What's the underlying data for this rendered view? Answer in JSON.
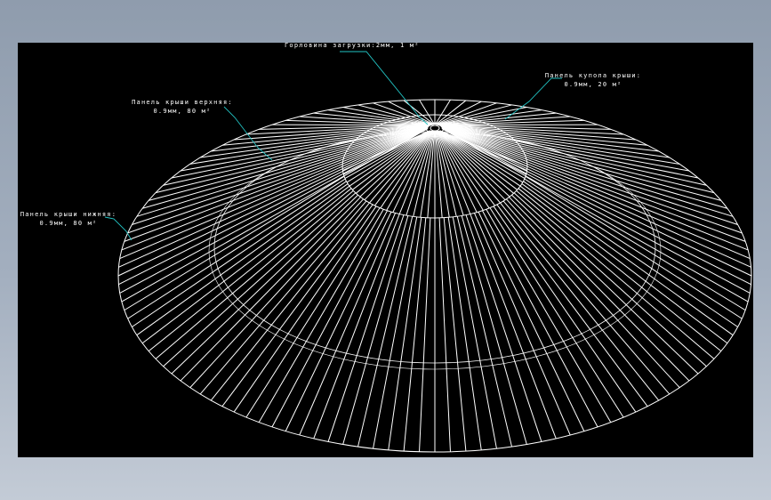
{
  "colors": {
    "frame_background": "#9aa6b6",
    "viewport_background": "#000000",
    "geometry_lines": "#ffffff",
    "leader_lines": "#22c3c3"
  },
  "annotations": [
    {
      "id": "throat",
      "line1": "Горловина загрузки:2мм, 1 м²",
      "line2": ""
    },
    {
      "id": "roof-cone-panel",
      "line1": "Панель купола крыши:",
      "line2": "0.9мм, 20 м²"
    },
    {
      "id": "roof-upper-panel",
      "line1": "Панель крыши верхняя:",
      "line2": "0.9мм, 80 м²"
    },
    {
      "id": "roof-lower-panel",
      "line1": "Панель крыши нижняя:",
      "line2": "0.9мм, 80 м²"
    }
  ]
}
